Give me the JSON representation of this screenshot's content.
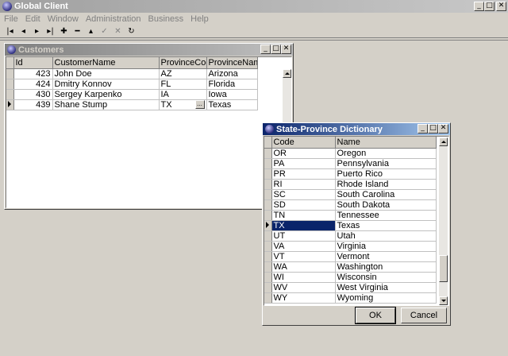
{
  "app": {
    "title": "Global Client"
  },
  "menu": [
    "File",
    "Edit",
    "Window",
    "Administration",
    "Business",
    "Help"
  ],
  "toolbar": {
    "icons": [
      "first-icon",
      "prev-icon",
      "next-icon",
      "last-icon",
      "add-icon",
      "delete-icon",
      "up-icon",
      "check-icon",
      "cancel-icon",
      "refresh-icon"
    ]
  },
  "customers": {
    "title": "Customers",
    "columns": [
      "Id",
      "CustomerName",
      "ProvinceCode",
      "ProvinceName"
    ],
    "rows": [
      {
        "id": "423",
        "name": "John Doe",
        "code": "AZ",
        "province": "Arizona"
      },
      {
        "id": "424",
        "name": "Dmitry Konnov",
        "code": "FL",
        "province": "Florida"
      },
      {
        "id": "430",
        "name": "Sergey Karpenko",
        "code": "IA",
        "province": "Iowa"
      },
      {
        "id": "439",
        "name": "Shane Stump",
        "code": "TX",
        "province": "Texas"
      }
    ],
    "ellipsis": "..."
  },
  "dictionary": {
    "title": "State-Province Dictionary",
    "columns": [
      "Code",
      "Name"
    ],
    "rows": [
      {
        "code": "OR",
        "name": "Oregon"
      },
      {
        "code": "PA",
        "name": "Pennsylvania"
      },
      {
        "code": "PR",
        "name": "Puerto Rico"
      },
      {
        "code": "RI",
        "name": "Rhode Island"
      },
      {
        "code": "SC",
        "name": "South Carolina"
      },
      {
        "code": "SD",
        "name": "South Dakota"
      },
      {
        "code": "TN",
        "name": "Tennessee"
      },
      {
        "code": "TX",
        "name": "Texas"
      },
      {
        "code": "UT",
        "name": "Utah"
      },
      {
        "code": "VA",
        "name": "Virginia"
      },
      {
        "code": "VT",
        "name": "Vermont"
      },
      {
        "code": "WA",
        "name": "Washington"
      },
      {
        "code": "WI",
        "name": "Wisconsin"
      },
      {
        "code": "WV",
        "name": "West Virginia"
      },
      {
        "code": "WY",
        "name": "Wyoming"
      }
    ],
    "selected_code": "TX",
    "ok_label": "OK",
    "cancel_label": "Cancel"
  },
  "colors": {
    "selection": "#0a246a",
    "active_title": "#0a246a"
  }
}
